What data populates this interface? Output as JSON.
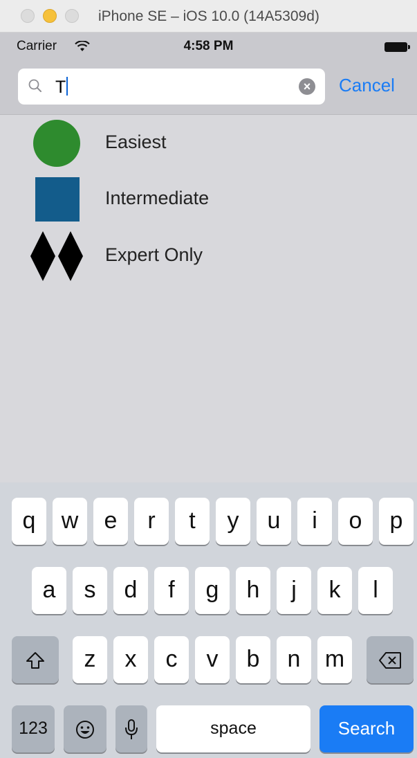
{
  "window": {
    "title": "iPhone SE – iOS 10.0 (14A5309d)"
  },
  "statusbar": {
    "carrier": "Carrier",
    "time": "4:58 PM"
  },
  "search": {
    "value": "T",
    "cancel_label": "Cancel"
  },
  "results": [
    {
      "label": "Easiest",
      "icon": "green-circle-icon",
      "color": "#2e8b2e"
    },
    {
      "label": "Intermediate",
      "icon": "blue-square-icon",
      "color": "#135c8b"
    },
    {
      "label": "Expert Only",
      "icon": "double-black-diamond-icon",
      "color": "#000000"
    }
  ],
  "keyboard": {
    "row1": [
      "q",
      "w",
      "e",
      "r",
      "t",
      "y",
      "u",
      "i",
      "o",
      "p"
    ],
    "row2": [
      "a",
      "s",
      "d",
      "f",
      "g",
      "h",
      "j",
      "k",
      "l"
    ],
    "row3": [
      "z",
      "x",
      "c",
      "v",
      "b",
      "n",
      "m"
    ],
    "numbers_label": "123",
    "space_label": "space",
    "search_label": "Search"
  },
  "colors": {
    "accent": "#1a7cf5",
    "status_bar": "#c9c9ce",
    "background": "#d8d8dc"
  }
}
